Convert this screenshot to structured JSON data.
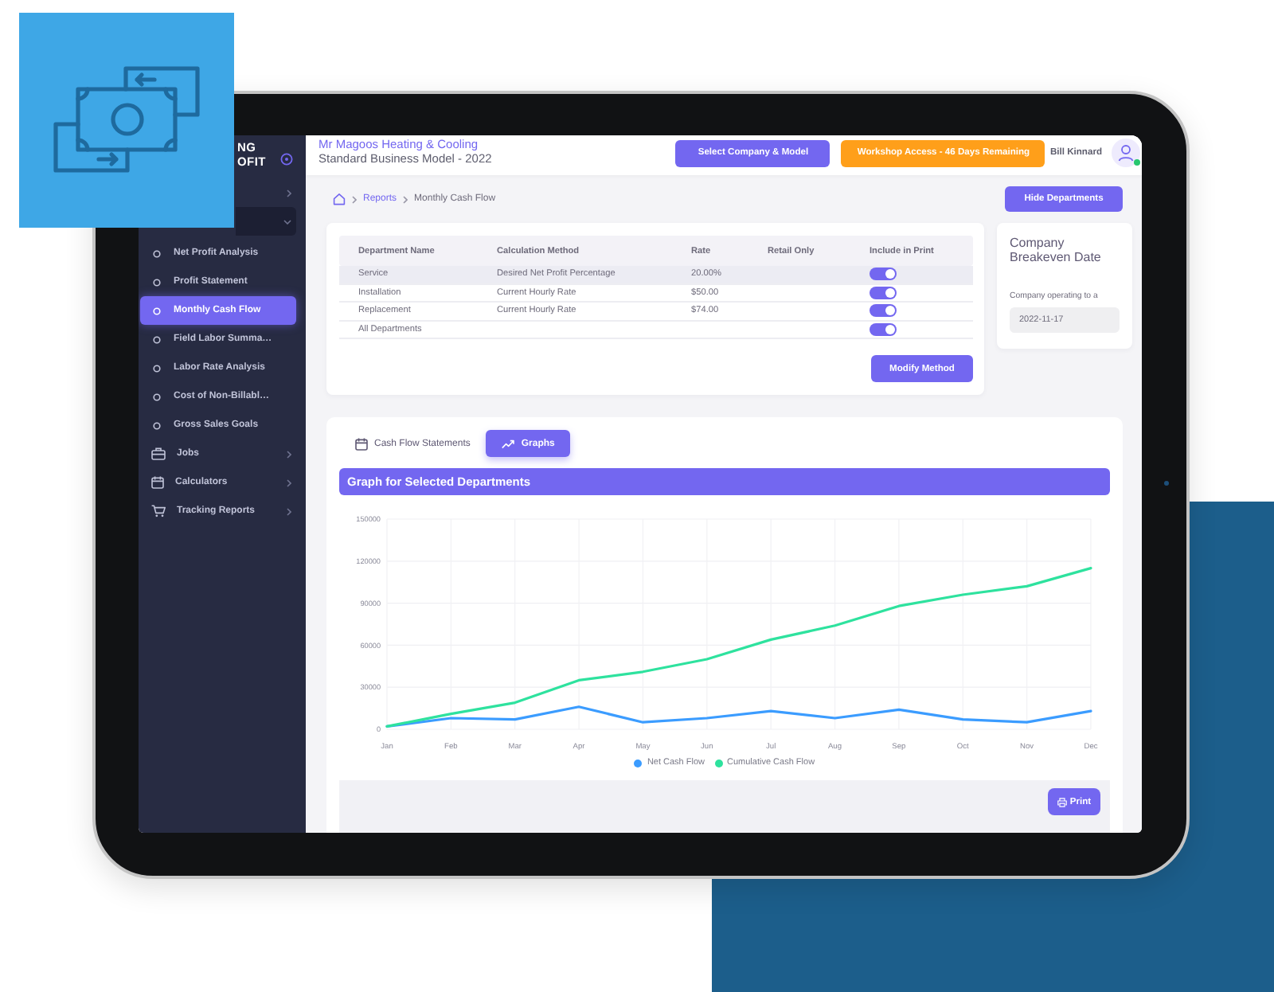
{
  "sidebar": {
    "logo_lines": [
      "NG",
      "OFIT"
    ],
    "items": [
      {
        "kind": "section",
        "expanded": false
      },
      {
        "kind": "section",
        "expanded": true
      },
      {
        "kind": "link",
        "label": "Net Profit Analysis",
        "selected": false
      },
      {
        "kind": "link",
        "label": "Profit Statement",
        "selected": false
      },
      {
        "kind": "link",
        "label": "Monthly Cash Flow",
        "selected": true
      },
      {
        "kind": "link",
        "label": "Field Labor Summa…",
        "selected": false
      },
      {
        "kind": "link",
        "label": "Labor Rate Analysis",
        "selected": false
      },
      {
        "kind": "link",
        "label": "Cost of Non-Billabl…",
        "selected": false
      },
      {
        "kind": "link",
        "label": "Gross Sales Goals",
        "selected": false
      },
      {
        "kind": "section",
        "label": "Jobs",
        "expanded": false
      },
      {
        "kind": "section",
        "label": "Calculators",
        "expanded": false
      },
      {
        "kind": "section",
        "label": "Tracking Reports",
        "expanded": false
      }
    ]
  },
  "header": {
    "company": "Mr Magoos Heating & Cooling",
    "model": "Standard Business Model - 2022",
    "buttons": [
      {
        "label": "Select Company & Model",
        "kind": "primary"
      },
      {
        "label": "Workshop Access - 46 Days Remaining",
        "kind": "warning"
      }
    ],
    "user": {
      "name": "Bill Kinnard",
      "online": true
    }
  },
  "breadcrumb": {
    "items": [
      "Reports",
      "Monthly Cash Flow"
    ],
    "action": "Hide Departments"
  },
  "departments": {
    "columns": [
      "Department Name",
      "Calculation Method",
      "Rate",
      "Retail Only",
      "Include in Print"
    ],
    "rows": [
      {
        "name": "Service",
        "method": "Desired Net Profit Percentage",
        "rate": "20.00%",
        "include_in_print": true,
        "selected": true
      },
      {
        "name": "Installation",
        "method": "Current Hourly Rate",
        "rate": "$50.00",
        "include_in_print": true,
        "selected": false
      },
      {
        "name": "Replacement",
        "method": "Current Hourly Rate",
        "rate": "$74.00",
        "include_in_print": true,
        "selected": false
      },
      {
        "name": "All Departments",
        "include_in_print": true,
        "selected": false
      }
    ],
    "button": "Modify Method"
  },
  "breakeven": {
    "title": "Company Breakeven Date",
    "label": "Company operating to a",
    "value": "2022-11-17"
  },
  "chart_panel": {
    "tabs": [
      {
        "label": "Cash Flow Statements",
        "selected": false
      },
      {
        "label": "Graphs",
        "selected": true
      }
    ],
    "banner": "Graph for Selected Departments",
    "chart_data": {
      "type": "line",
      "grid": true,
      "categories": [
        "Jan",
        "Feb",
        "Mar",
        "Apr",
        "May",
        "Jun",
        "Jul",
        "Aug",
        "Sep",
        "Oct",
        "Nov",
        "Dec"
      ],
      "ylim": [
        0,
        150000
      ],
      "yticks": [
        0,
        30000,
        60000,
        90000,
        120000,
        150000
      ],
      "series": [
        {
          "name": "Net Cash Flow",
          "color": "#3b9cff",
          "values": [
            2000,
            8000,
            7000,
            16000,
            5000,
            8000,
            13000,
            8000,
            14000,
            7000,
            5000,
            13000
          ]
        },
        {
          "name": "Cumulative Cash Flow",
          "color": "#2ee29e",
          "values": [
            2000,
            11000,
            19000,
            35000,
            41000,
            50000,
            64000,
            74000,
            88000,
            96000,
            102000,
            115000
          ]
        }
      ]
    },
    "print_button": "Print"
  }
}
